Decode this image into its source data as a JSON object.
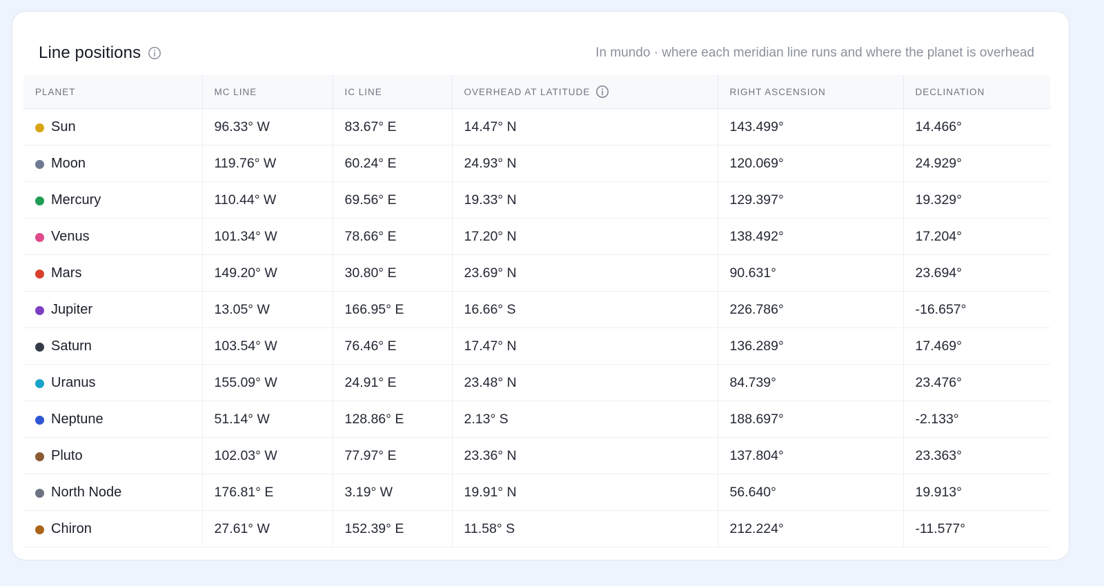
{
  "card": {
    "title": "Line positions",
    "subtitle": "In mundo · where each meridian line runs and where the planet is overhead"
  },
  "table": {
    "columns": [
      "PLANET",
      "MC LINE",
      "IC LINE",
      "OVERHEAD AT LATITUDE",
      "RIGHT ASCENSION",
      "DECLINATION"
    ],
    "rows": [
      {
        "planet": "Sun",
        "color": "#d9a514",
        "mc": "96.33° W",
        "ic": "83.67° E",
        "overhead": "14.47° N",
        "ra": "143.499°",
        "dec": "14.466°"
      },
      {
        "planet": "Moon",
        "color": "#6e7a92",
        "mc": "119.76° W",
        "ic": "60.24° E",
        "overhead": "24.93° N",
        "ra": "120.069°",
        "dec": "24.929°"
      },
      {
        "planet": "Mercury",
        "color": "#1f9d55",
        "mc": "110.44° W",
        "ic": "69.56° E",
        "overhead": "19.33° N",
        "ra": "129.397°",
        "dec": "19.329°"
      },
      {
        "planet": "Venus",
        "color": "#de4a8a",
        "mc": "101.34° W",
        "ic": "78.66° E",
        "overhead": "17.20° N",
        "ra": "138.492°",
        "dec": "17.204°"
      },
      {
        "planet": "Mars",
        "color": "#d9402c",
        "mc": "149.20° W",
        "ic": "30.80° E",
        "overhead": "23.69° N",
        "ra": "90.631°",
        "dec": "23.694°"
      },
      {
        "planet": "Jupiter",
        "color": "#7a3fc2",
        "mc": "13.05° W",
        "ic": "166.95° E",
        "overhead": "16.66° S",
        "ra": "226.786°",
        "dec": "-16.657°"
      },
      {
        "planet": "Saturn",
        "color": "#333b4a",
        "mc": "103.54° W",
        "ic": "76.46° E",
        "overhead": "17.47° N",
        "ra": "136.289°",
        "dec": "17.469°"
      },
      {
        "planet": "Uranus",
        "color": "#1aa3c8",
        "mc": "155.09° W",
        "ic": "24.91° E",
        "overhead": "23.48° N",
        "ra": "84.739°",
        "dec": "23.476°"
      },
      {
        "planet": "Neptune",
        "color": "#2f56d3",
        "mc": "51.14° W",
        "ic": "128.86° E",
        "overhead": "2.13° S",
        "ra": "188.697°",
        "dec": "-2.133°"
      },
      {
        "planet": "Pluto",
        "color": "#8a5a33",
        "mc": "102.03° W",
        "ic": "77.97° E",
        "overhead": "23.36° N",
        "ra": "137.804°",
        "dec": "23.363°"
      },
      {
        "planet": "North Node",
        "color": "#6b7383",
        "mc": "176.81° E",
        "ic": "3.19° W",
        "overhead": "19.91° N",
        "ra": "56.640°",
        "dec": "19.913°"
      },
      {
        "planet": "Chiron",
        "color": "#a9651a",
        "mc": "27.61° W",
        "ic": "152.39° E",
        "overhead": "11.58° S",
        "ra": "212.224°",
        "dec": "-11.577°"
      }
    ]
  }
}
